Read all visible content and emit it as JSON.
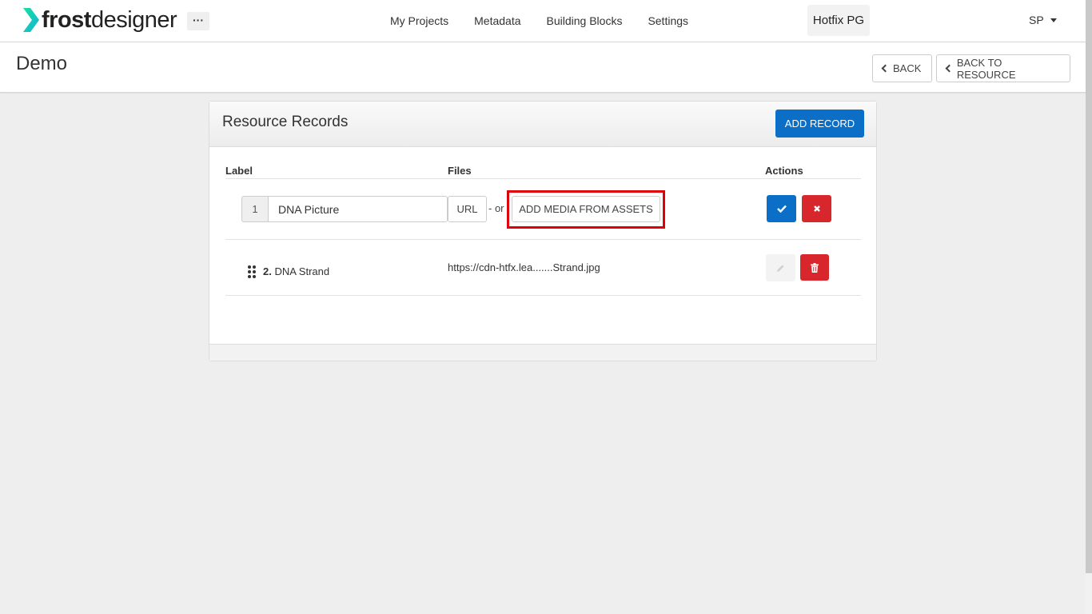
{
  "app": {
    "logo_bold": "frost",
    "logo_light": "designer",
    "more_label": "···",
    "nav": [
      "My Projects",
      "Metadata",
      "Building Blocks",
      "Settings"
    ],
    "org": "Hotfix PG",
    "user": "SP"
  },
  "page": {
    "title": "Demo",
    "back_label": "BACK",
    "back_to_resource_label": "BACK TO RESOURCE"
  },
  "panel": {
    "title": "Resource Records",
    "add_record_label": "ADD RECORD",
    "columns": {
      "label": "Label",
      "files": "Files",
      "actions": "Actions"
    }
  },
  "edit_row": {
    "number": "1",
    "label_value": "DNA Picture",
    "url_label": "URL",
    "or_text": "- or",
    "add_media_label": "ADD MEDIA FROM ASSETS"
  },
  "records": [
    {
      "number": "2.",
      "label": "DNA Strand",
      "file": "https://cdn-htfx.lea.......Strand.jpg"
    }
  ],
  "colors": {
    "primary": "#0b6ec7",
    "danger": "#d8272c",
    "highlight": "#e0000a",
    "logo_accent": "#19d6a2"
  }
}
